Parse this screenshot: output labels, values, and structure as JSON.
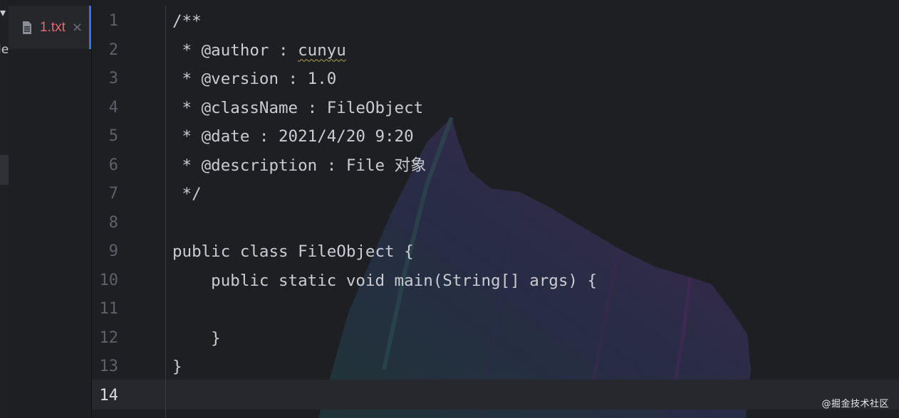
{
  "tab": {
    "label": "1.txt",
    "close": "×",
    "icon": "text-file-icon"
  },
  "left_panel": {
    "glyph_top": "▾",
    "glyph_text": "le"
  },
  "editor": {
    "lines": [
      {
        "num": "1",
        "pre": "/**",
        "mark": "",
        "post": ""
      },
      {
        "num": "2",
        "pre": " * @author : ",
        "mark": "cunyu",
        "post": ""
      },
      {
        "num": "3",
        "pre": " * @version : 1.0",
        "mark": "",
        "post": ""
      },
      {
        "num": "4",
        "pre": " * @className : FileObject",
        "mark": "",
        "post": ""
      },
      {
        "num": "5",
        "pre": " * @date : 2021/4/20 9:20",
        "mark": "",
        "post": ""
      },
      {
        "num": "6",
        "pre": " * @description : File 对象",
        "mark": "",
        "post": ""
      },
      {
        "num": "7",
        "pre": " */",
        "mark": "",
        "post": ""
      },
      {
        "num": "8",
        "pre": "",
        "mark": "",
        "post": ""
      },
      {
        "num": "9",
        "pre": "public class FileObject {",
        "mark": "",
        "post": ""
      },
      {
        "num": "10",
        "pre": "    public static void main(String[] args) {",
        "mark": "",
        "post": ""
      },
      {
        "num": "11",
        "pre": "",
        "mark": "",
        "post": ""
      },
      {
        "num": "12",
        "pre": "    }",
        "mark": "",
        "post": ""
      },
      {
        "num": "13",
        "pre": "}",
        "mark": "",
        "post": ""
      },
      {
        "num": "14",
        "pre": "",
        "mark": "",
        "post": ""
      }
    ],
    "current_line": "14"
  },
  "watermark": "@掘金技术社区",
  "colors": {
    "accent": "#3574f0",
    "tab_text": "#e06c75",
    "code_text": "#c9ccd3"
  }
}
